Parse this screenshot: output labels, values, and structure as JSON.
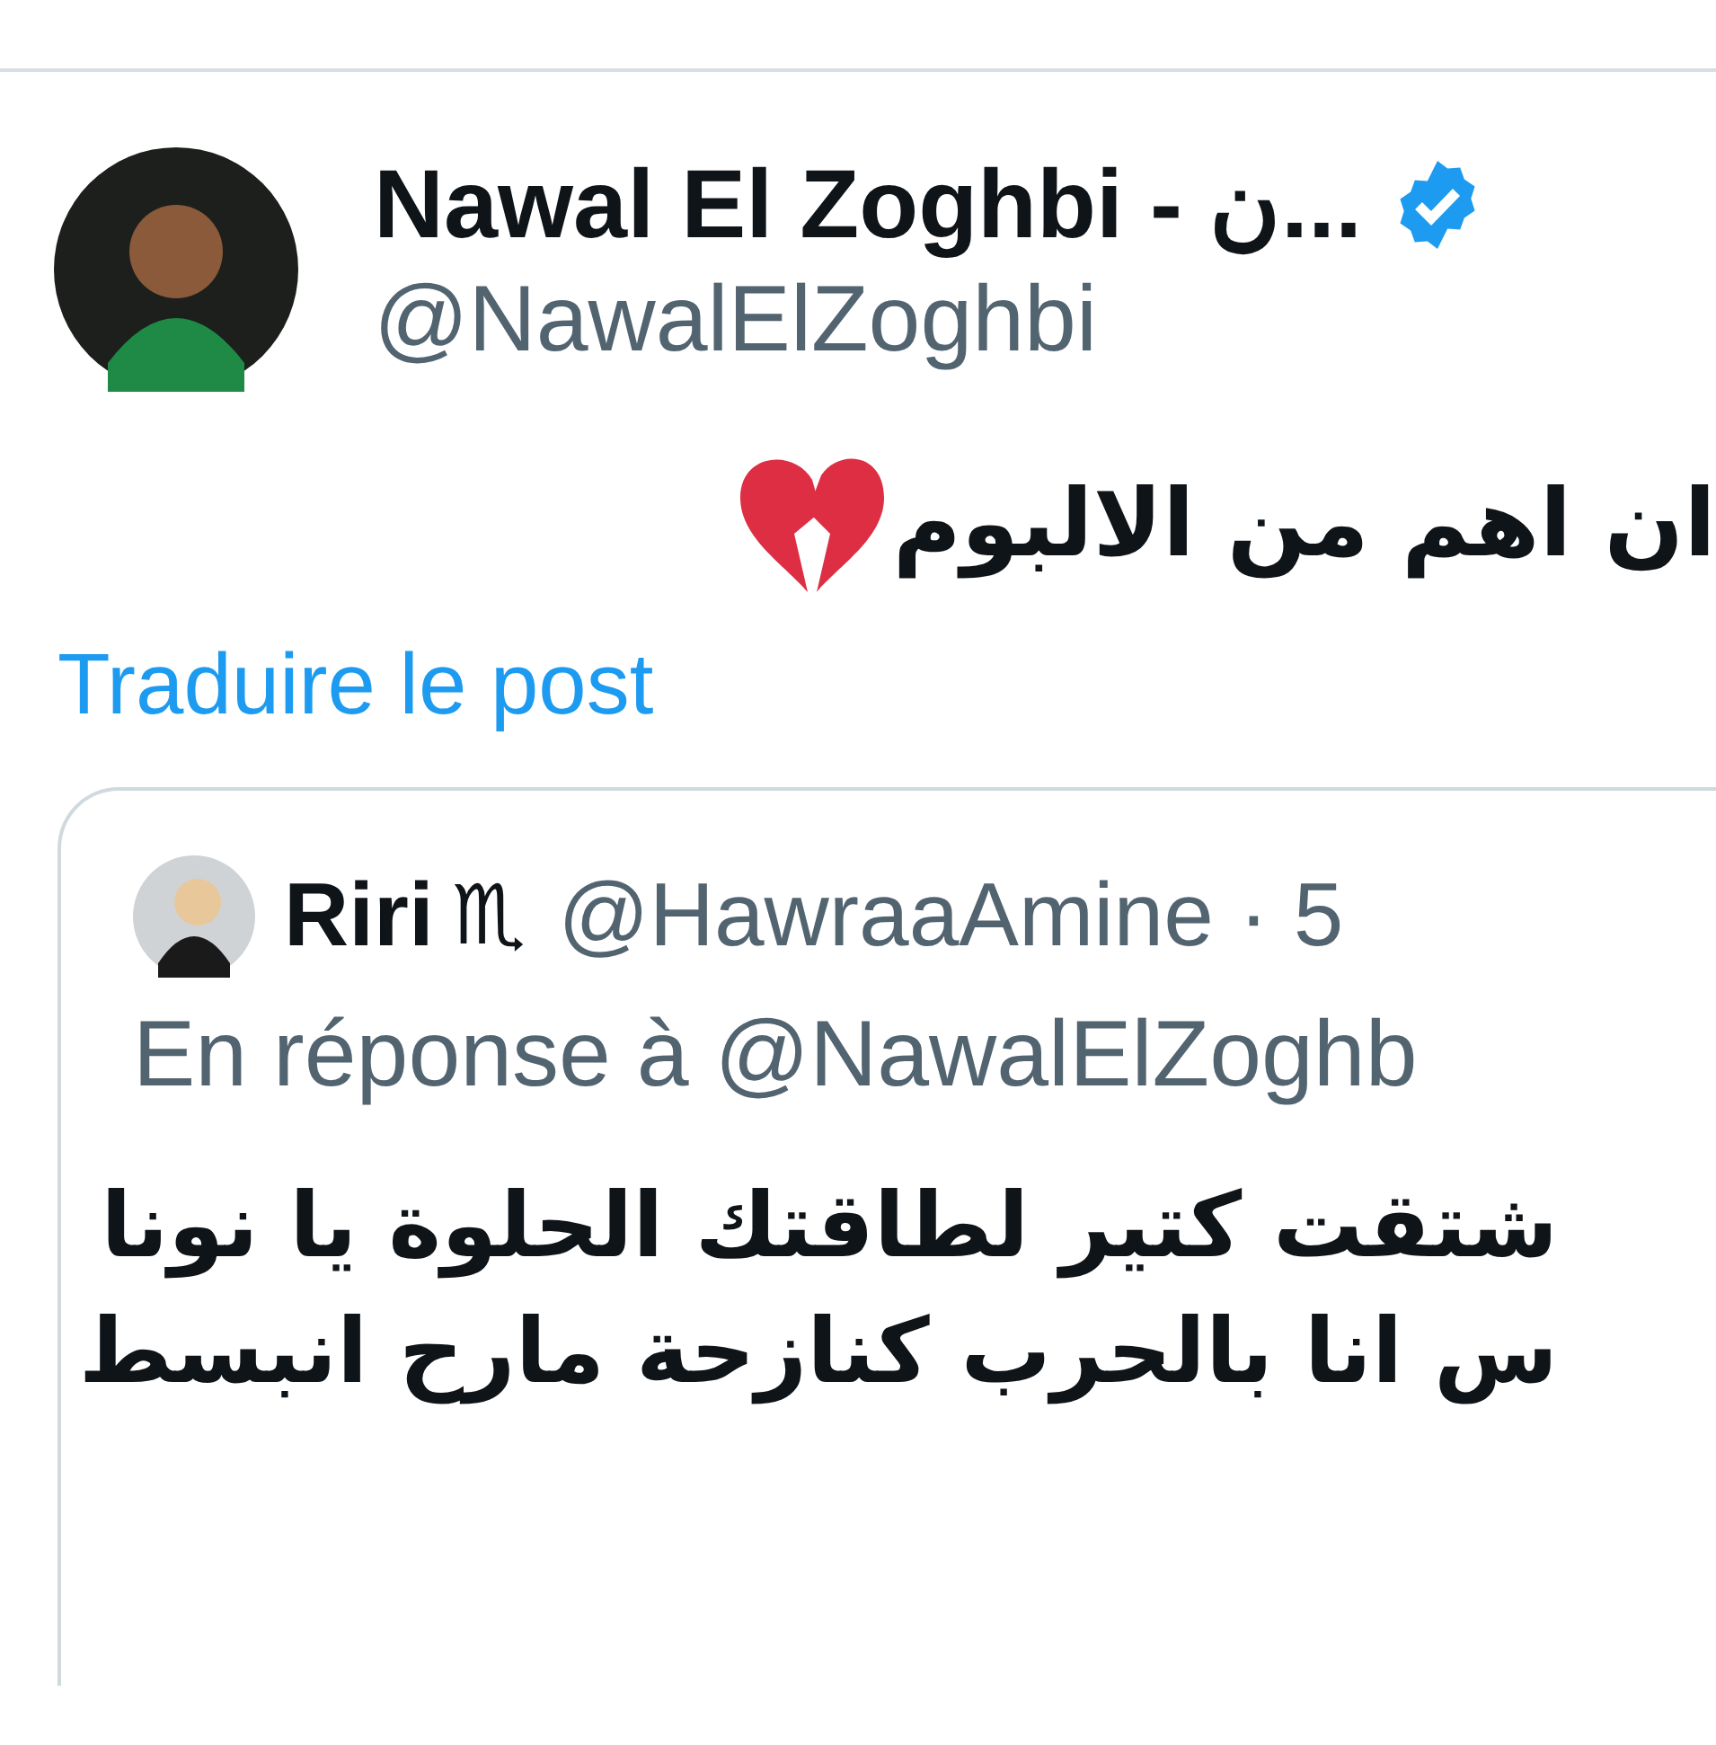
{
  "post": {
    "author_name": "Nawal El Zoghbi - ن...",
    "verified": true,
    "handle": "@NawalElZoghbi",
    "text": "ان اهم من الالبوم",
    "translate_link": "Traduire le post"
  },
  "quoted_post": {
    "author_name": "Riri",
    "zodiac": "♏",
    "handle": "@HawraaAmine",
    "time": "· 5",
    "reply_to": "En réponse à @NawalElZoghb",
    "lines": [
      "شتقت كتير لطاقتك الحلوة يا نونا",
      "س انا بالحرب كنازحة مارح انبسط"
    ]
  }
}
